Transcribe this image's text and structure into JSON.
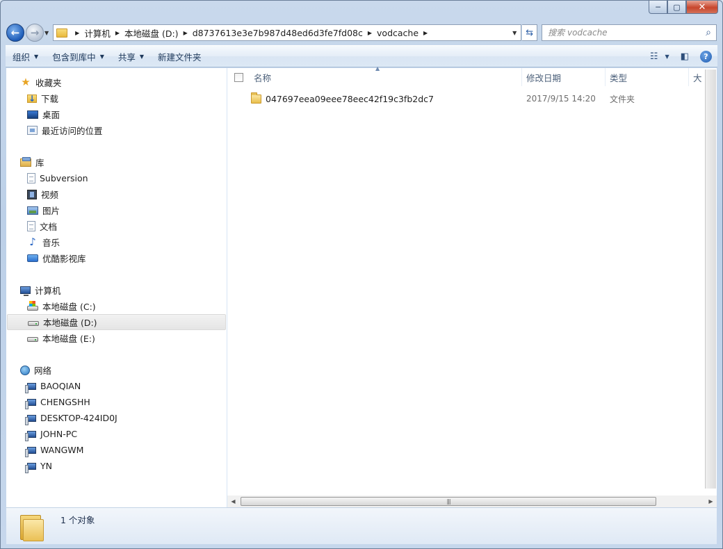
{
  "window": {
    "caption_buttons": {
      "minimize": "─",
      "maximize": "▢",
      "close": "✕"
    }
  },
  "address": {
    "crumbs": [
      "计算机",
      "本地磁盘 (D:)",
      "d8737613e3e7b987d48ed6d3fe7fd08c",
      "vodcache"
    ]
  },
  "search": {
    "placeholder": "搜索 vodcache"
  },
  "toolbar": {
    "organize": "组织",
    "include_in_library": "包含到库中",
    "share": "共享",
    "new_folder": "新建文件夹"
  },
  "nav": {
    "favorites": {
      "label": "收藏夹",
      "items": [
        {
          "label": "下载",
          "icon": "download-folder-icon"
        },
        {
          "label": "桌面",
          "icon": "desktop-icon"
        },
        {
          "label": "最近访问的位置",
          "icon": "recent-places-icon"
        }
      ]
    },
    "libraries": {
      "label": "库",
      "items": [
        {
          "label": "Subversion",
          "icon": "subversion-library-icon"
        },
        {
          "label": "视频",
          "icon": "video-library-icon"
        },
        {
          "label": "图片",
          "icon": "picture-library-icon"
        },
        {
          "label": "文档",
          "icon": "document-library-icon"
        },
        {
          "label": "音乐",
          "icon": "music-library-icon"
        },
        {
          "label": "优酷影视库",
          "icon": "youku-library-icon"
        }
      ]
    },
    "computer": {
      "label": "计算机",
      "items": [
        {
          "label": "本地磁盘 (C:)",
          "icon": "system-drive-icon"
        },
        {
          "label": "本地磁盘 (D:)",
          "icon": "drive-icon",
          "selected": true
        },
        {
          "label": "本地磁盘 (E:)",
          "icon": "drive-icon"
        }
      ]
    },
    "network": {
      "label": "网络",
      "items": [
        {
          "label": "BAOQIAN",
          "icon": "network-computer-icon"
        },
        {
          "label": "CHENGSHH",
          "icon": "network-computer-icon"
        },
        {
          "label": "DESKTOP-424ID0J",
          "icon": "network-computer-icon"
        },
        {
          "label": "JOHN-PC",
          "icon": "network-computer-icon"
        },
        {
          "label": "WANGWM",
          "icon": "network-computer-icon"
        },
        {
          "label": "YN",
          "icon": "network-computer-icon"
        }
      ]
    }
  },
  "columns": {
    "name": "名称",
    "modified": "修改日期",
    "type": "类型",
    "size": "大"
  },
  "files": [
    {
      "name": "047697eea09eee78eec42f19c3fb2dc7",
      "modified": "2017/9/15 14:20",
      "type": "文件夹"
    }
  ],
  "details": {
    "count_text": "1 个对象"
  }
}
